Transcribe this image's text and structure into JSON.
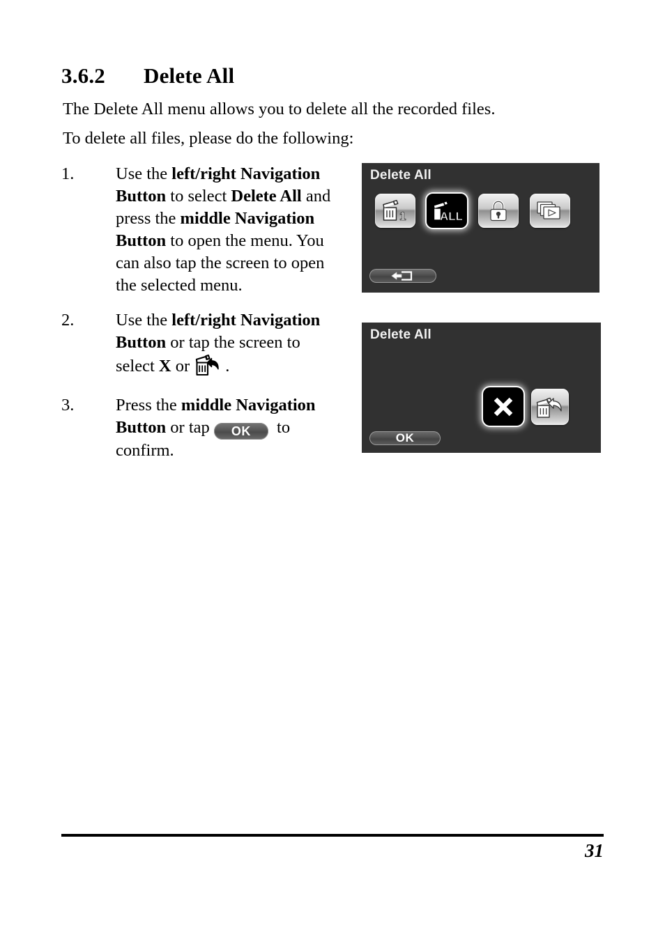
{
  "document": {
    "section_number": "3.6.2",
    "section_title": "Delete All",
    "intro_paragraph_1": "The Delete All menu allows you to delete all the recorded files.",
    "intro_paragraph_2": "To delete all files, please do the following:",
    "page_number": "31"
  },
  "steps": [
    {
      "number": "1.",
      "parts": {
        "t1": "Use the ",
        "b1": "left/right Navigation Button",
        "t2": " to select ",
        "b2": "Delete All",
        "t3": " and press the ",
        "b3": "middle Navigation Button",
        "t4": " to open the menu. You can also tap the screen to open the selected menu."
      }
    },
    {
      "number": "2.",
      "parts": {
        "t1": "Use the ",
        "b1": "left/right Navigation Button",
        "t2": " or tap the screen to select ",
        "b2": "X",
        "t3": " or ",
        "t4": "."
      },
      "inline_icon": "trash-undo-icon"
    },
    {
      "number": "3.",
      "parts": {
        "t1": "Press the ",
        "b1": "middle Navigation Button",
        "t2": " or tap ",
        "t3": " to confirm."
      },
      "inline_button_label": "OK"
    }
  ],
  "screen_1": {
    "title": "Delete All",
    "icons": [
      {
        "name": "delete-one-icon",
        "label": "1",
        "selected": false
      },
      {
        "name": "delete-all-icon",
        "label": "ALL",
        "selected": true
      },
      {
        "name": "lock-icon",
        "label": "",
        "selected": false
      },
      {
        "name": "slideshow-icon",
        "label": "",
        "selected": false
      }
    ],
    "bottom_button": {
      "name": "exit-button",
      "label": ""
    }
  },
  "screen_2": {
    "title": "Delete All",
    "icons": [
      {
        "name": "cancel-x-icon",
        "label": "X",
        "selected": true
      },
      {
        "name": "trash-undo-icon",
        "label": "",
        "selected": false
      }
    ],
    "bottom_button": {
      "name": "ok-button",
      "label": "OK"
    }
  },
  "colors": {
    "screen_background": "#313131",
    "screen_title_text": "#f2f2f2",
    "page_text": "#000000",
    "page_background": "#ffffff"
  }
}
